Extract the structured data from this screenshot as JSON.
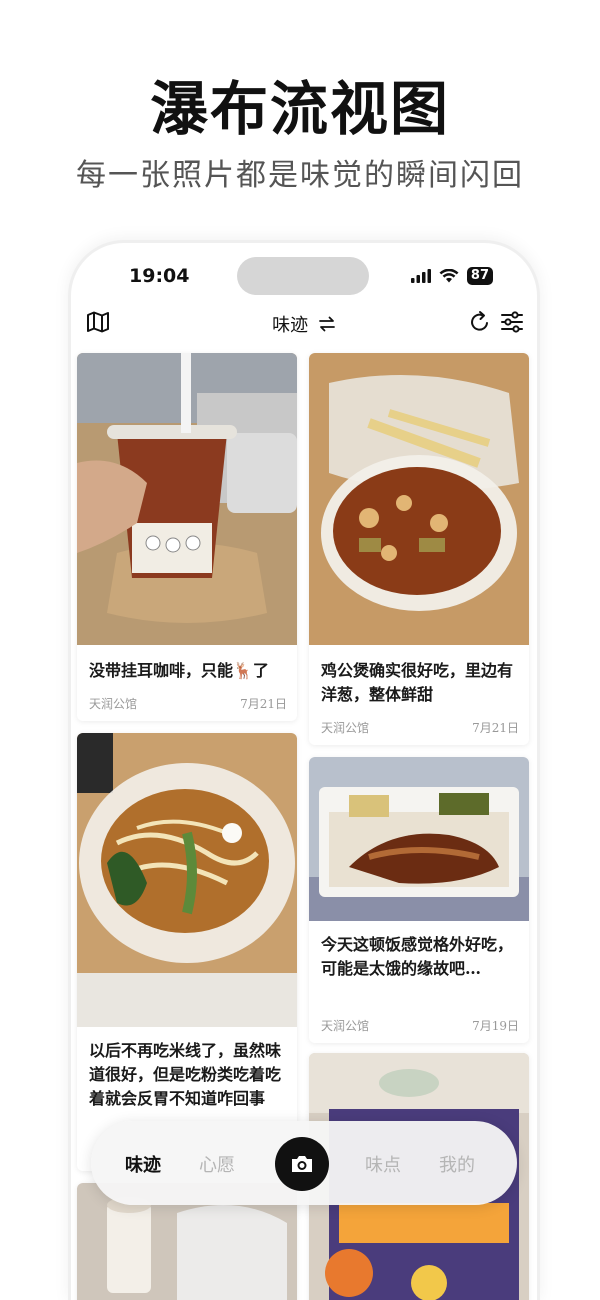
{
  "promo": {
    "title": "瀑布流视图",
    "subtitle": "每一张照片都是味觉的瞬间闪回"
  },
  "status_bar": {
    "time": "19:04",
    "battery": "87"
  },
  "app_bar": {
    "title": "味迹",
    "icons": [
      "map-icon",
      "swap-icon",
      "refresh-icon",
      "filter-icon"
    ]
  },
  "feed": {
    "cards": [
      {
        "caption": "没带挂耳咖啡，只能🦌了",
        "location": "天润公馆",
        "date": "7月21日"
      },
      {
        "caption": "鸡公煲确实很好吃，里边有洋葱，整体鲜甜",
        "location": "天润公馆",
        "date": "7月21日"
      },
      {
        "caption": "今天这顿饭感觉格外好吃，可能是太饿的缘故吧…",
        "location": "天润公馆",
        "date": "7月19日"
      },
      {
        "caption": "以后不再吃米线了，虽然味道很好，但是吃粉类吃着吃着就会反胃不知道咋回事",
        "location": "",
        "date": ""
      }
    ]
  },
  "tab_bar": {
    "tabs": [
      "味迹",
      "心愿",
      "味点",
      "我的"
    ],
    "active": "味迹",
    "camera_icon": "camera-icon"
  },
  "colors": {
    "active_tab": "#111111",
    "inactive_tab": "#b5b5b5",
    "meta_text": "#999999"
  }
}
